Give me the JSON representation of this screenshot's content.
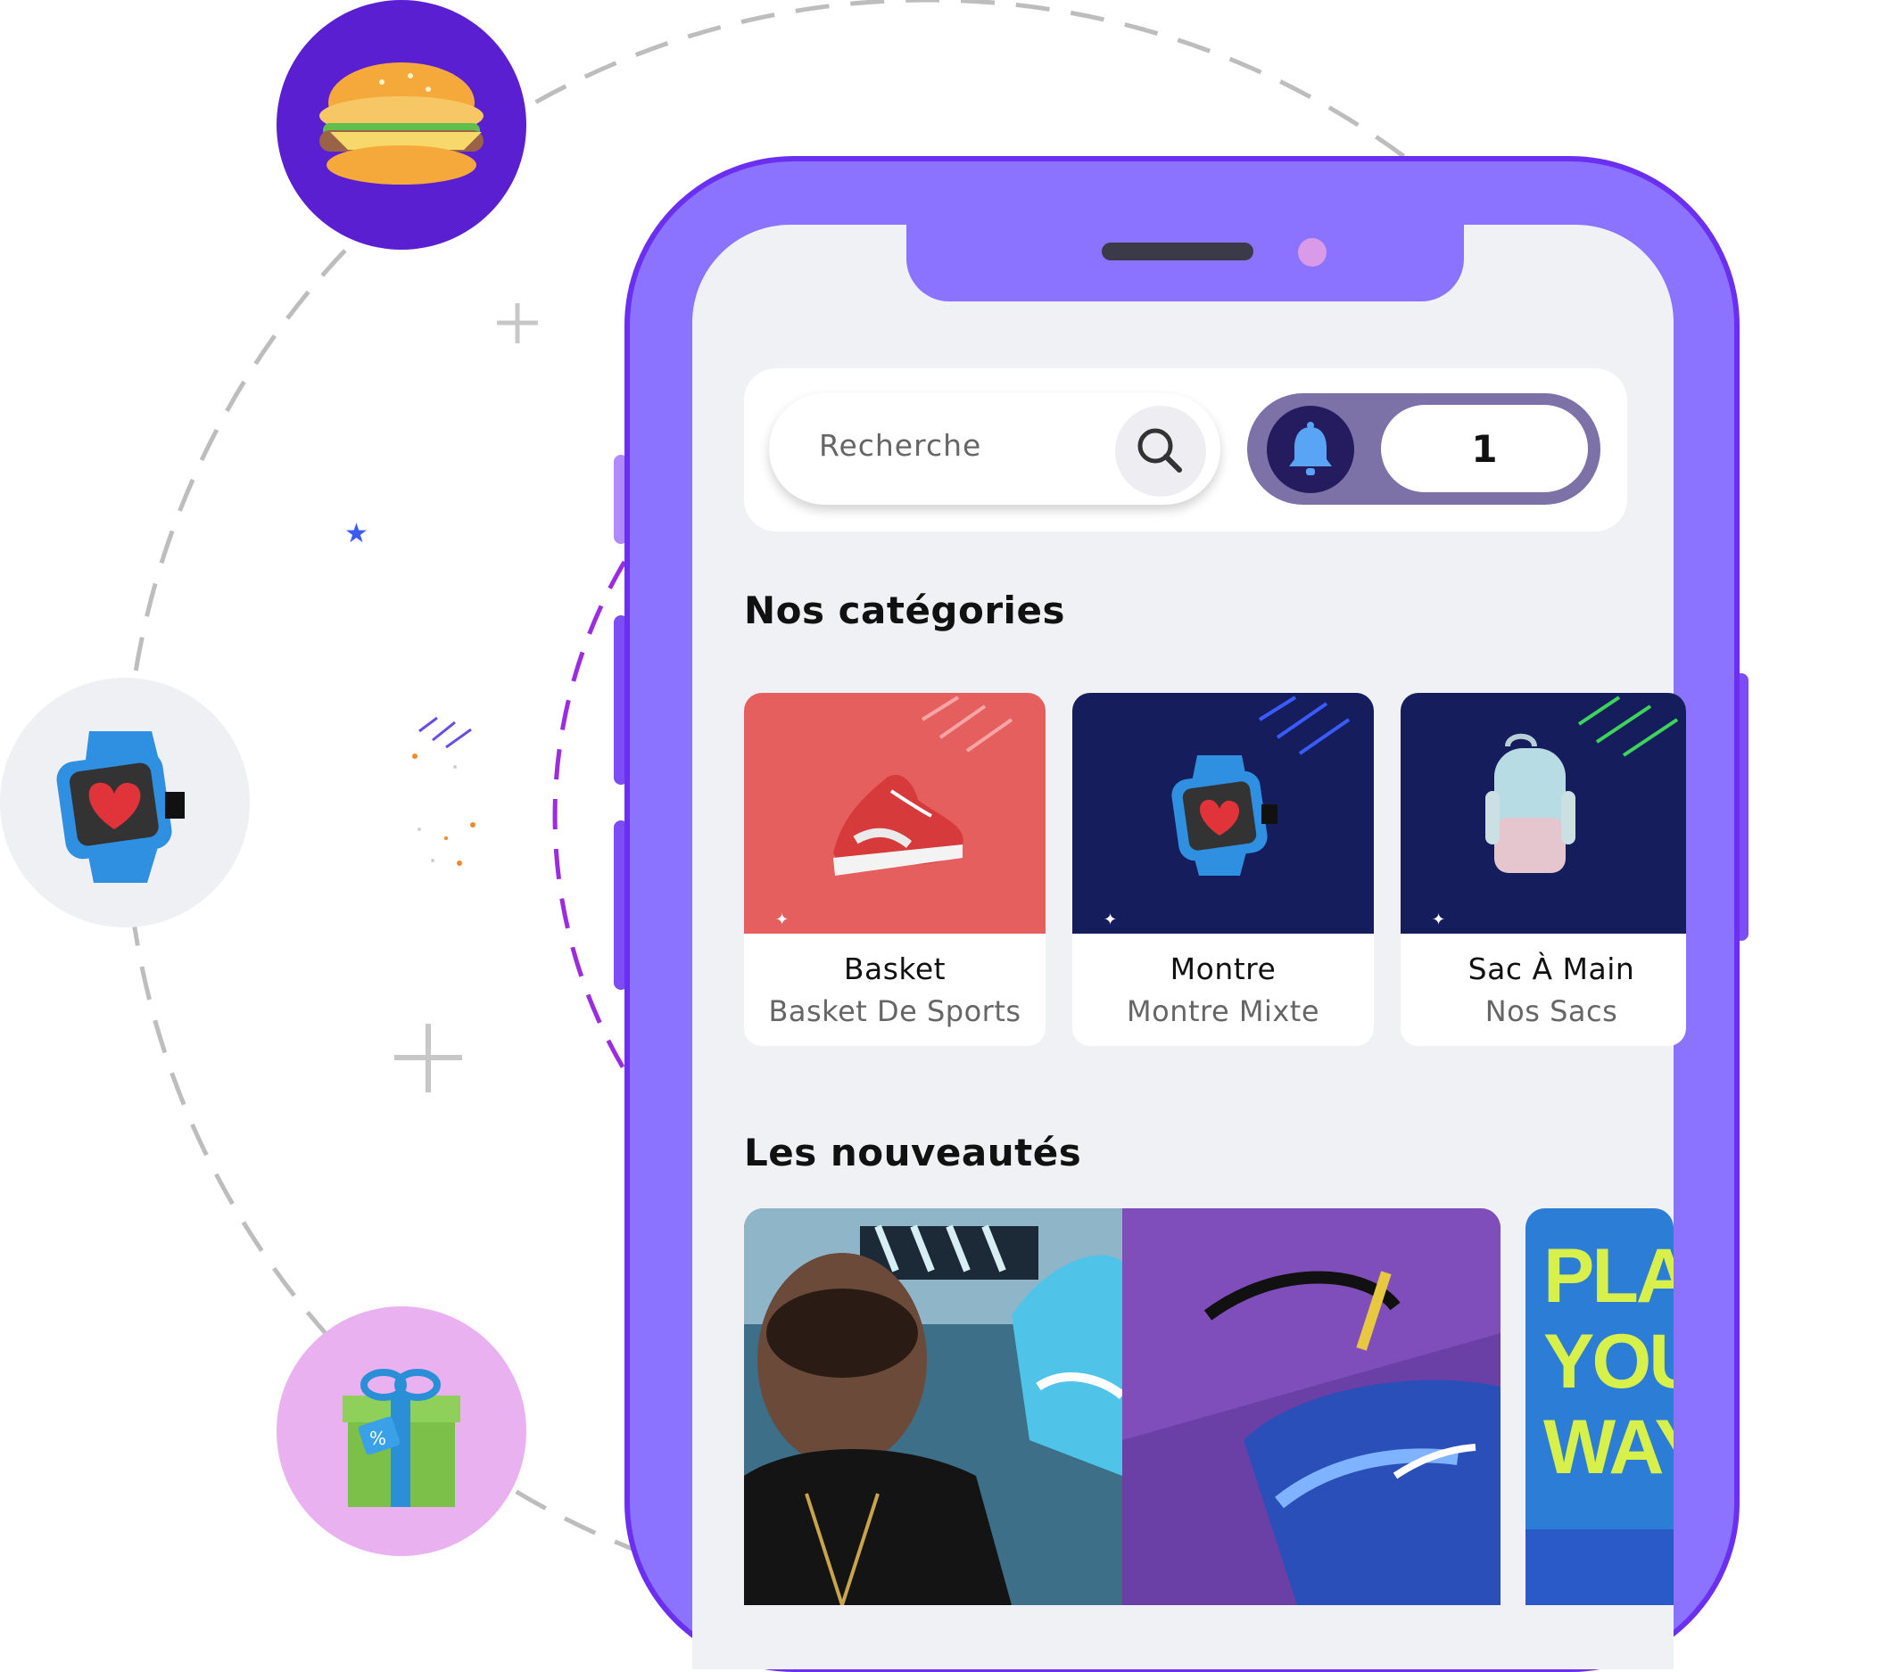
{
  "search": {
    "placeholder": "Recherche"
  },
  "notifications": {
    "count": "1"
  },
  "sections": {
    "categories_title": "Nos catégories",
    "new_title": "Les nouveautés"
  },
  "categories": [
    {
      "name": "Basket",
      "subtitle": "Basket De Sports",
      "background": "#e55f5f"
    },
    {
      "name": "Montre",
      "subtitle": "Montre Mixte",
      "background": "#151d5c"
    },
    {
      "name": "Sac À Main",
      "subtitle": "Nos Sacs",
      "background": "#151d5c"
    }
  ],
  "new_arrivals": {
    "banner_text": [
      "PLA",
      "YOU",
      "WAY"
    ]
  },
  "colors": {
    "phone": "#8b72ff",
    "phone_border": "#6a2ff0",
    "screen": "#f0f1f5",
    "accent_dark": "#241c5e"
  }
}
